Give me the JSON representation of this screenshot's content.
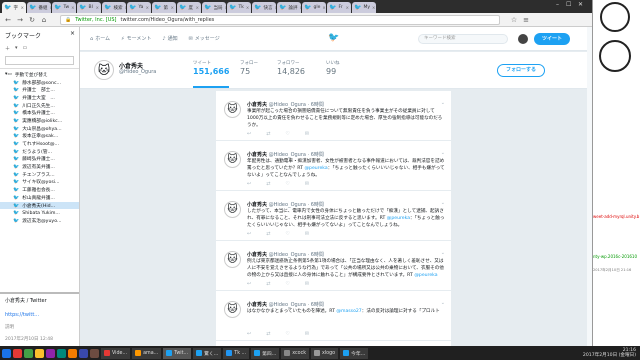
{
  "browser": {
    "tabs": [
      {
        "label": "字",
        "active": true
      },
      {
        "label": "番組"
      },
      {
        "label": "Tw"
      },
      {
        "label": "Bl"
      },
      {
        "label": "検索"
      },
      {
        "label": "Ya"
      },
      {
        "label": "第"
      },
      {
        "label": "度"
      },
      {
        "label": "当局"
      },
      {
        "label": "Tk"
      },
      {
        "label": "快言"
      },
      {
        "label": "論評"
      },
      {
        "label": "gle"
      },
      {
        "label": "Fr"
      },
      {
        "label": "My"
      }
    ],
    "url_domain_tag": "Twitter, Inc. [US]",
    "url": "twitter.com/Hideo_Ogura/with_replies"
  },
  "sidebar": {
    "title": "ブックマーク",
    "close": "×",
    "folder": "手動で並び替え",
    "items": [
      "静水部部@sonc...",
      "弁護士　部士...",
      "弁護士大室　...",
      "川口正久先生...",
      "橋本弘弁護士...",
      "実應橋部@iolikc...",
      "大山崇昌@ohya...",
      "坂本正幸@sak...",
      "てれすHsoot@...",
      "だうよう(管...",
      "藤崎弘弁護士...",
      "渡辺有美弁護...",
      "チエンプラス...",
      "サイキ収@yosi...",
      "工藤雅也会長...",
      "杉山真龍弁護...",
      "小倉秀夫(Hid...",
      "Shibata Yukim...",
      "渡辺玄治@yuyo..."
    ],
    "selected_index": 16,
    "lower_title": "小倉秀夫 / Twitter",
    "lower_link": "https://twitt...",
    "lower_desc": "説明",
    "lower_time": "2017年2月10日 12:48"
  },
  "twitter": {
    "nav": [
      {
        "icon": "home-icon",
        "glyph": "⌂",
        "label": "ホーム"
      },
      {
        "icon": "moments-icon",
        "glyph": "⚡",
        "label": "モーメント"
      },
      {
        "icon": "bell-icon",
        "glyph": "♪",
        "label": "通知"
      },
      {
        "icon": "mail-icon",
        "glyph": "✉",
        "label": "メッセージ"
      }
    ],
    "search_placeholder": "キーワード検索",
    "tweet_button": "ツイート",
    "profile": {
      "name": "小倉秀夫",
      "handle": "@Hideo_Ogura",
      "stats": [
        {
          "label": "ツイート",
          "value": "151,666",
          "active": true
        },
        {
          "label": "フォロー",
          "value": "75"
        },
        {
          "label": "フォロワー",
          "value": "14,826"
        },
        {
          "label": "いいね",
          "value": "99"
        }
      ],
      "follow_button": "フォローする"
    },
    "tweets": [
      {
        "name": "小倉秀夫",
        "handle": "@Hideo_Ogura",
        "time": "6時間",
        "text": "事業所が起こった場合の損害賠償責任について無限責任を負う事業主がその従業員に対して1000万以上の責任を負わせることを業務規則等に定めた場合、厚生の強制指導は可能なのだろうか。"
      },
      {
        "name": "小倉秀夫",
        "handle": "@Hideo_Ogura",
        "time": "6時間",
        "text": "年配男性は、通勤電車・痴漢加害者、女性が被害者となる事件報道においては、裁判法官を詰め罵ったと思っていたか？RT ",
        "mention": "@peureka",
        "text2": "：「ちょっと触ったくらいいいじゃない、相手も嫌がってないよ」ってことなんでしょうね。"
      },
      {
        "name": "小倉秀夫",
        "handle": "@Hideo_Ogura",
        "time": "6時間",
        "text": "したがって、本当に、電車内で女性の身体にちょっと触っただけで「痴漢」として逮捕、起訴され、有罪になること、それは刑事司法立法に反すると思います。RT ",
        "mention": "@peureka",
        "text2": "：「ちょっと触ったくらいいいじゃない、相手も嫌がってないよ」ってことなんでしょうね。"
      },
      {
        "name": "小倉秀夫",
        "handle": "@Hideo_Ogura",
        "time": "6時間",
        "text": "例えば東京都迷惑防止条例第5条第1項の場合は、「正当な理由なく、人を著しく羞恥させ、又は人に不安を覚えさせるような行為」であって「公共の場所又は公共の乗物において、衣服その他の物の上から又は直接に人の身体に触れること」が構成要件とされています。RT ",
        "mention": "@peureka",
        "text2": ""
      },
      {
        "name": "小倉秀夫",
        "handle": "@Hideo_Ogura",
        "time": "6時間",
        "text": "はなかなかまとまっていたものを陣述。RT ",
        "mention": "@masso27",
        "text2": "：法の反対は論理に対する「プロルト"
      }
    ]
  },
  "taskbar": {
    "apps": [
      "Vide...",
      "ama...",
      "Twit...",
      "驚く...",
      "Tk ...",
      "第四...",
      "xcock",
      "xlogo",
      "今年..."
    ],
    "time": "21:16",
    "date": "2017年2月10日 (金曜日)"
  },
  "right_panel": {
    "red_text": "weet-add-myrql.unity.b",
    "green_text": "nty-wp.2016c-201610",
    "small_text": "2017年2月10日 21:16"
  }
}
